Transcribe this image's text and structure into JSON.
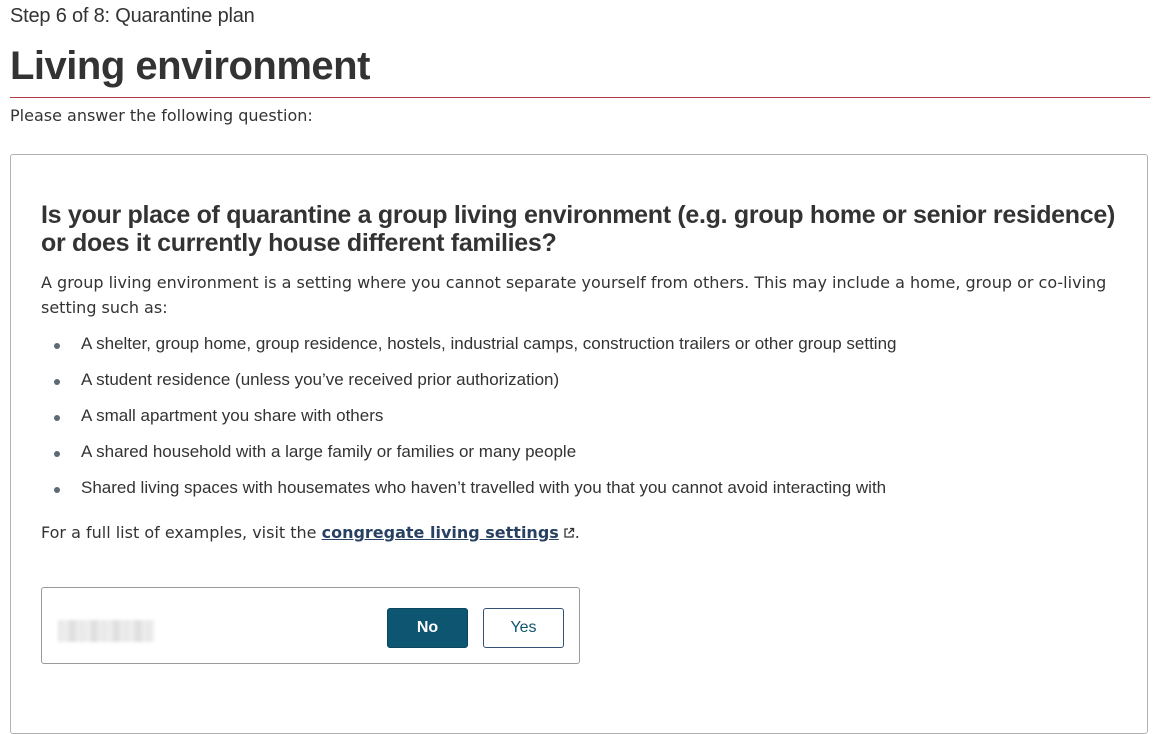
{
  "header": {
    "step": "Step 6 of 8: Quarantine plan",
    "title": "Living environment",
    "intro": "Please answer the following question:"
  },
  "question": {
    "heading": "Is your place of quarantine a group living environment (e.g. group home or senior residence) or does it currently house different families?",
    "description": "A group living environment is a setting where you cannot separate yourself from others. This may include a home, group or co-living setting such as:",
    "examples": [
      "A shelter, group home, group residence, hostels, industrial camps, construction trailers or other group setting",
      "A student residence (unless you’ve received prior authorization)",
      "A small apartment you share with others",
      "A shared household with a large family or families or many people",
      "Shared living spaces with housemates who haven’t travelled with you that you cannot avoid interacting with"
    ],
    "full_list_prefix": "For a full list of examples, visit the ",
    "full_list_link": "congregate living settings",
    "full_list_suffix": "."
  },
  "answer": {
    "no_label": "No",
    "yes_label": "Yes",
    "icon": "external-link-icon"
  },
  "colors": {
    "accent_rule": "#af3c43",
    "primary_button": "#0e5571",
    "link": "#284162"
  }
}
